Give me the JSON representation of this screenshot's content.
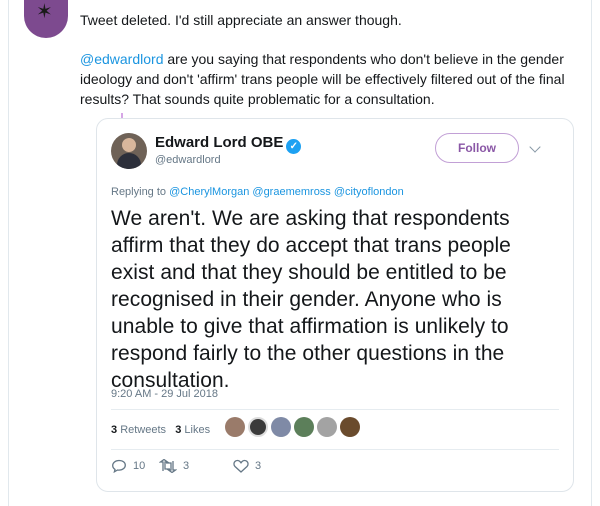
{
  "reply": {
    "line1": "Tweet deleted. I'd still appreciate an answer though.",
    "mention": "@edwardlord",
    "text": " are you saying that respondents who don't believe in the gender ideology and don't 'affirm' trans people will be effectively filtered out of the final results? That sounds quite problematic for a consultation."
  },
  "quote": {
    "name": "Edward Lord OBE",
    "handle": "@edwardlord",
    "follow_label": "Follow",
    "replying_prefix": "Replying to ",
    "replying_mentions": "@CherylMorgan @graememross @cityoflondon",
    "body": "We aren't. We are asking that respondents affirm that they do accept that trans people exist and that they should be entitled to be recognised in their gender. Anyone who is unable to give that affirmation is unlikely to respond fairly to the other questions in the consultation.",
    "timestamp": "9:20 AM - 29 Jul 2018",
    "retweets_count": "3",
    "retweets_label": "Retweets",
    "likes_count": "3",
    "likes_label": "Likes",
    "reply_count": "10",
    "retweet_action_count": "3",
    "like_action_count": "3"
  },
  "colors": {
    "link": "#1b95e0",
    "follow": "#8a57a6",
    "verified": "#1da1f2",
    "avatar_bg": "#7d4a8f"
  },
  "icons": [
    "verified-icon",
    "chevron-down-icon",
    "reply-icon",
    "retweet-icon",
    "heart-icon"
  ]
}
